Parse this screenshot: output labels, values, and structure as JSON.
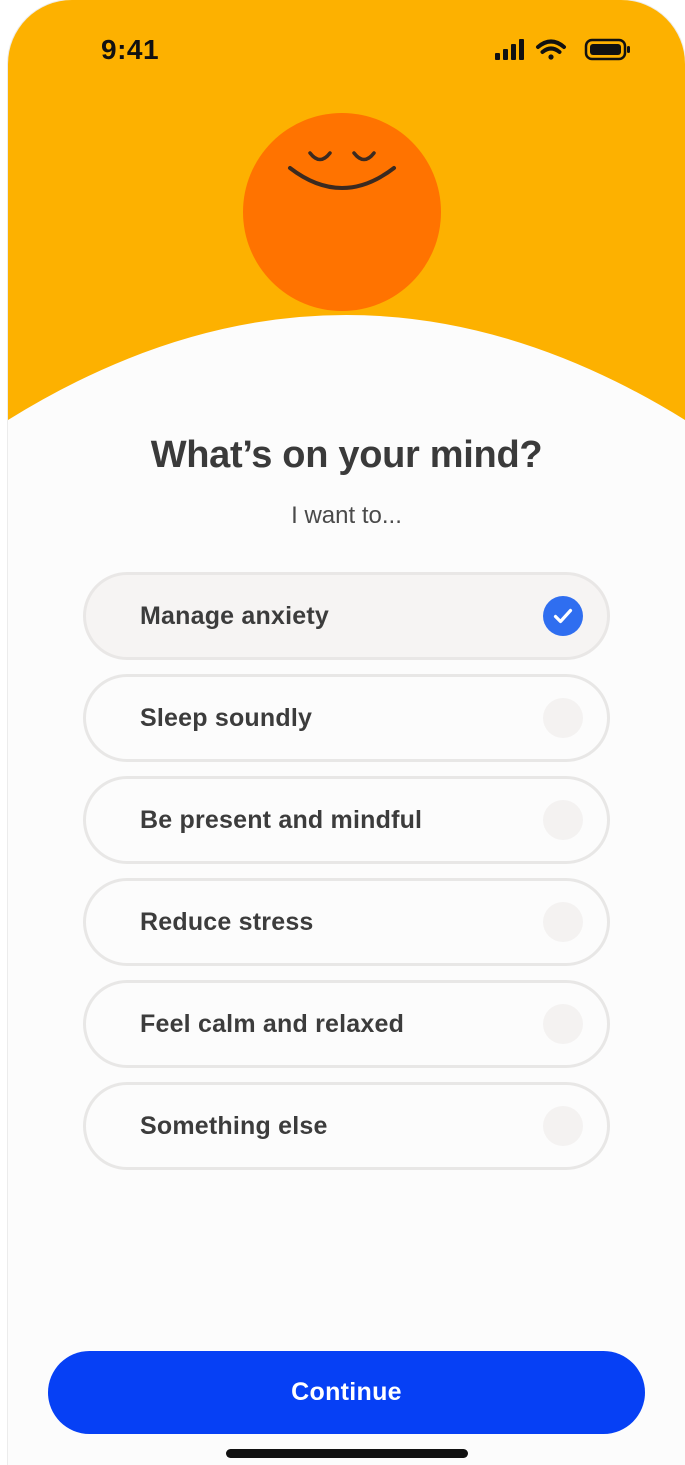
{
  "status_bar": {
    "time": "9:41",
    "icons": [
      "cellular-signal-icon",
      "wifi-icon",
      "battery-icon"
    ]
  },
  "hero": {
    "background_color": "#FDB100",
    "character_color": "#FF7300",
    "icon": "smiling-face-icon"
  },
  "question": {
    "title": "What’s on your mind?",
    "subtitle": "I want to..."
  },
  "options": [
    {
      "label": "Manage anxiety",
      "selected": true
    },
    {
      "label": "Sleep soundly",
      "selected": false
    },
    {
      "label": "Be present and mindful",
      "selected": false
    },
    {
      "label": "Reduce stress",
      "selected": false
    },
    {
      "label": "Feel calm and relaxed",
      "selected": false
    },
    {
      "label": "Something else",
      "selected": false
    }
  ],
  "continue_button": {
    "label": "Continue",
    "color": "#0640F5"
  },
  "accent_colors": {
    "checkbox_selected": "#2F6EF0"
  }
}
